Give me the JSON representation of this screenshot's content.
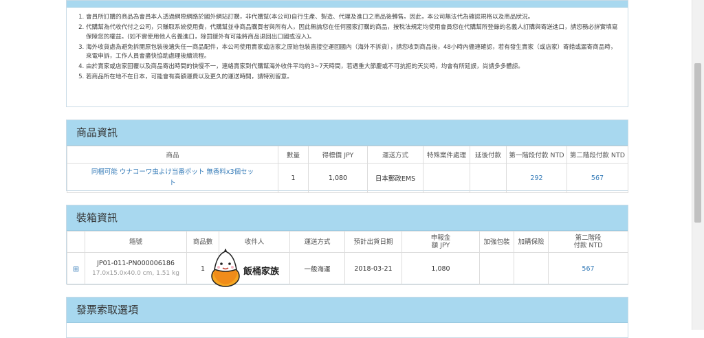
{
  "notice": {
    "items": [
      "會員所訂購的商品為會員本人透過網際網路於國外網站訂購，非代購幫(本公司)自行生產、製造、代理及進口之商品後轉售。因此，本公司無法代為確認規格以及商品狀況。",
      "代購幫為代收代付之公司，只賺取系統使用費，代購幫並非商品購買者與所有人，因此無論您在任何國家訂購的商品，按稅法規定均使用會員您在代購幫所登錄的名義人訂購與寄送進口，請您務必詳實填寫保障您的權益。(如不實使用他人名義進口，除罰鍰外有可能將商品退回出口國或沒入)。",
      "海外收貨處為避免拆開原包裝後遺失任一商品配件，本公司使用賣家或店家之原始包裝直接空運回國內（海外不拆貨），請您收到商品後，48小時內儘速確認，若有發生賣家（或店家）寄錯或漏寄商品時，來電申訴，工作人員會盡快協助處理後續流程。",
      "由於賣家或店家回覆以及商品寄出時間的快慢不一，連絡賣家到代購幫海外收件平均約3~7天時間，若遇重大節慶或不可抗拒的天災時，均會有所延誤，尚請多多體諒。",
      "若商品所在地不在日本，可能會有高額運費以及更久的運送時間，請特別留意。"
    ]
  },
  "product": {
    "title": "商品資訊",
    "headers": [
      "商品",
      "數量",
      "得標價 JPY",
      "運送方式",
      "特殊案件處理",
      "延後付款",
      "第一階段付款 NTD",
      "第二階段付款 NTD"
    ],
    "row": {
      "name": "同梱可能 ウナコーワ虫よけ当番ポット 無香料x3個セット",
      "qty": "1",
      "price": "1,080",
      "shipping": "日本郵政EMS",
      "special": "",
      "deferred": "",
      "stage1": "292",
      "stage2": "567"
    }
  },
  "packing": {
    "title": "裝箱資訊",
    "headers": [
      "",
      "箱號",
      "商品數",
      "收件人",
      "運送方式",
      "預計出貨日期",
      "申報金額 JPY",
      "加強包裝",
      "加購保險",
      "第二階段付款 NTD"
    ],
    "row": {
      "expand": "⊞",
      "box_no": "JP01-011-PN000006186",
      "dims": "17.0x15.0x40.0 cm, 1.51 kg",
      "count": "1",
      "recipient": "",
      "shipping": "一般海運",
      "ship_date": "2018-03-21",
      "declared": "1,080",
      "reinforce": "",
      "insurance": "",
      "stage2": "567"
    }
  },
  "invoice": {
    "title": "發票索取選項"
  },
  "watermark": {
    "text": "飯桶家族"
  }
}
